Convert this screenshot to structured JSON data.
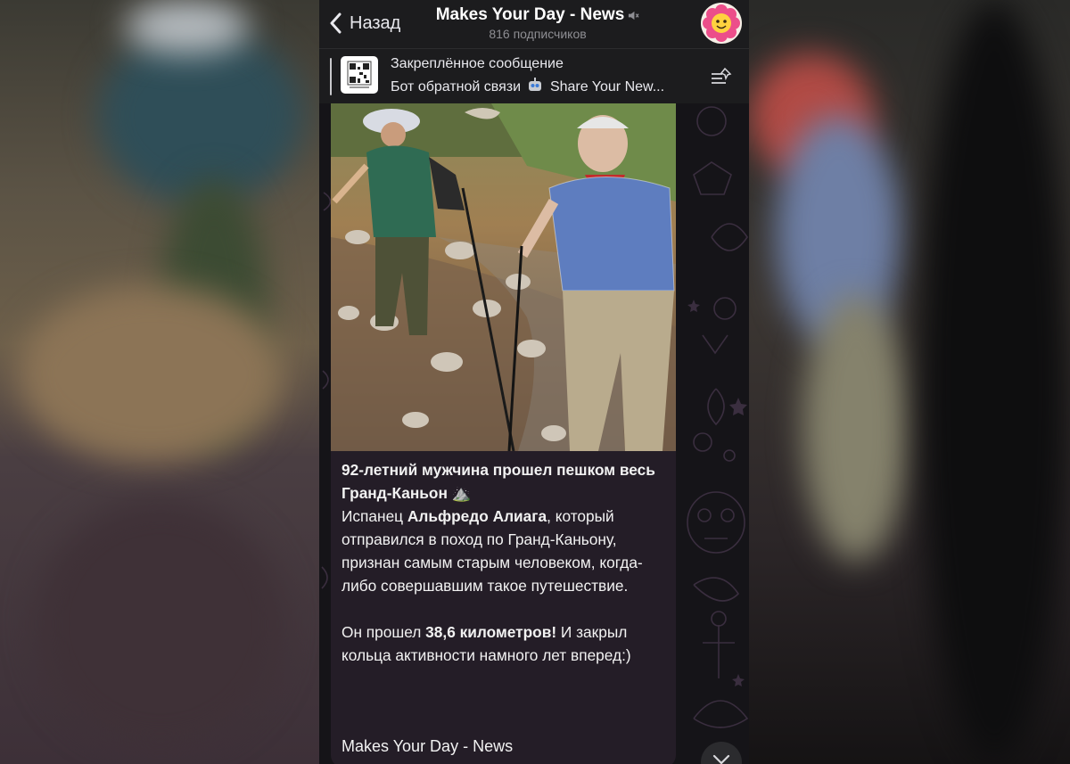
{
  "header": {
    "back_label": "Назад",
    "channel_title": "Makes Your Day - News",
    "subscribers": "816 подписчиков"
  },
  "pinned": {
    "title": "Закреплённое сообщение",
    "text_before": "Бот обратной связи",
    "text_after": "Share Your New..."
  },
  "post": {
    "headline": "92-летний мужчина прошел пешком весь Гранд-Каньон",
    "headline_emoji": "⛰️",
    "p1_before": "Испанец",
    "p1_bold": "Альфредо Алиага",
    "p1_after": ", который отправился в поход по Гранд-Каньону, признан самым старым человеком, когда-либо совершавшим такое путешествие.",
    "p2_before": "Он прошел",
    "p2_bold": "38,6 километров!",
    "p2_after": "И закрыл кольца активности намного лет вперед:)",
    "channel_signature": "Makes Your Day - News"
  },
  "colors": {
    "header_bg": "#1c1c1e",
    "bubble_bg": "#241d27",
    "chat_bg": "#151418",
    "muted_text": "#8e8e93"
  }
}
